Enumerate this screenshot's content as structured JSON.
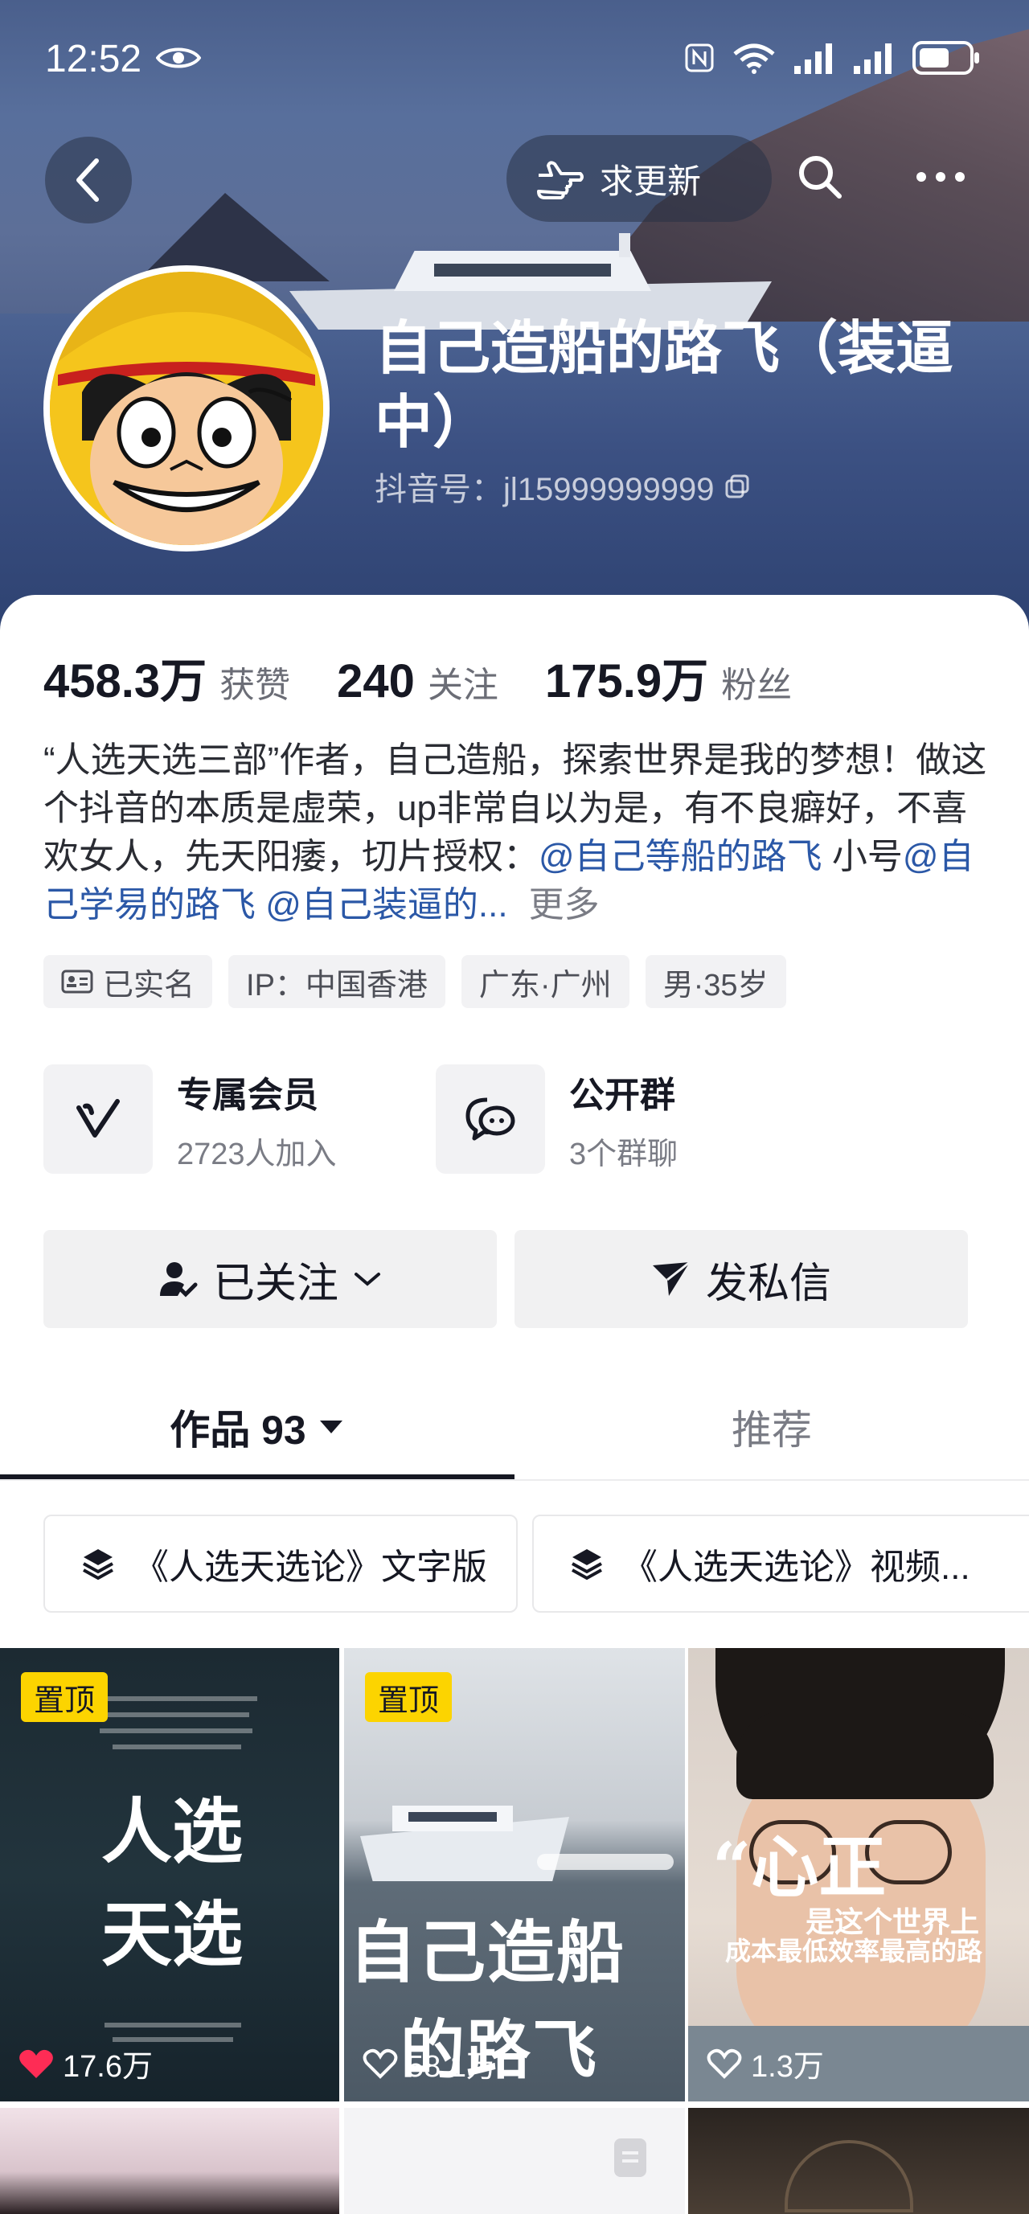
{
  "status_bar": {
    "time": "12:52"
  },
  "header": {
    "request_update_label": "求更新",
    "name": "自己造船的路飞（装逼中）",
    "douyin_id": "抖音号：jl15999999999"
  },
  "stats": [
    {
      "value": "458.3万",
      "label": "获赞"
    },
    {
      "value": "240",
      "label": "关注"
    },
    {
      "value": "175.9万",
      "label": "粉丝"
    }
  ],
  "bio": {
    "text": "“人选天选三部”作者，自己造船，探索世界是我的梦想！做这个抖音的本质是虚荣，up非常自以为是，有不良癖好，不喜欢女人，先天阳痿，切片授权：",
    "link1": "@自己等船的路飞",
    "mid": " 小号",
    "link2": "@自己学易的路飞",
    "link3": " @自己装逼的...",
    "more": "更多"
  },
  "tags": [
    "已实名",
    "IP：中国香港",
    "广东·广州",
    "男·35岁"
  ],
  "features": [
    {
      "title": "专属会员",
      "subtitle": "2723人加入"
    },
    {
      "title": "公开群",
      "subtitle": "3个群聊"
    }
  ],
  "actions": {
    "following": "已关注",
    "message": "发私信"
  },
  "tabs": [
    {
      "label": "作品 93"
    },
    {
      "label": "推荐"
    }
  ],
  "collections": [
    "《人选天选论》文字版",
    "《人选天选论》视频..."
  ],
  "videos": [
    {
      "pinned": "置顶",
      "likes": "17.6万",
      "cover_title_1": "人选",
      "cover_title_2": "天选"
    },
    {
      "pinned": "置顶",
      "likes": "58.1万",
      "cover_title_1": "自己造船",
      "cover_title_2": "的路飞"
    },
    {
      "likes": "1.3万",
      "cover_title_1": "“心正",
      "cover_title_2": "是这个世界上",
      "cover_title_3": "成本最低效率最高的路"
    }
  ],
  "colors": {
    "accent_link": "#2b58a7",
    "pin_badge": "#fcd400",
    "like_red": "#fe2c55"
  }
}
